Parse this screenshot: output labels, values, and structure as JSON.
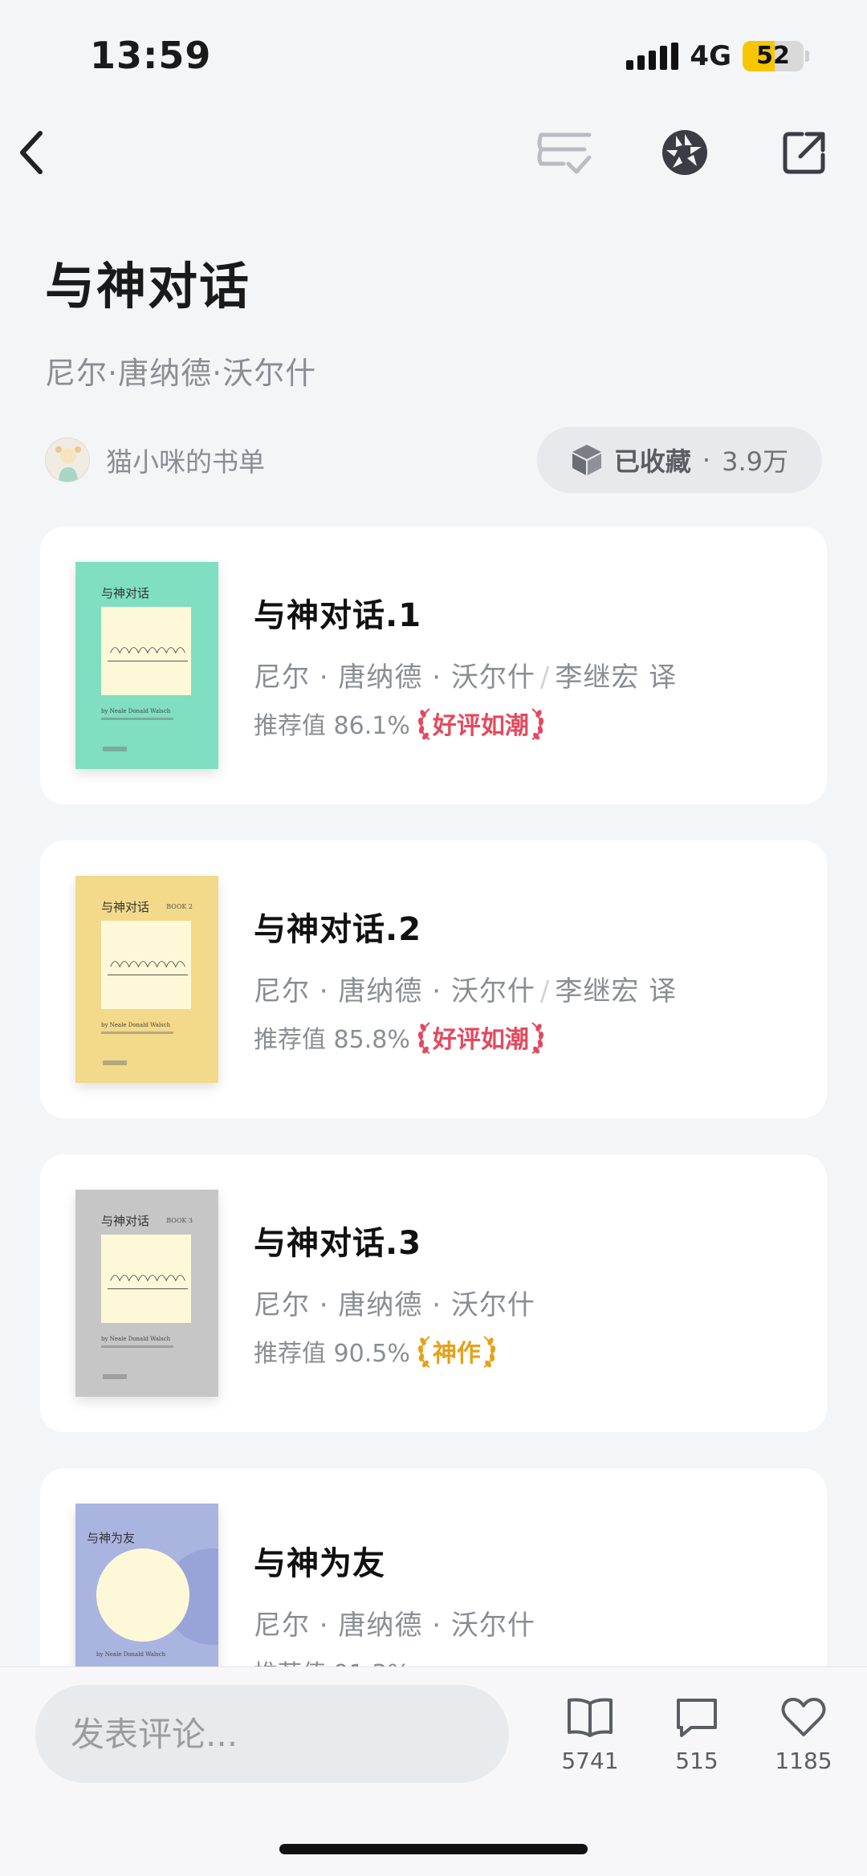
{
  "status_bar": {
    "time": "13:59",
    "network": "4G",
    "battery": "52"
  },
  "nav": {
    "back_icon": "chevron-left-icon",
    "list_check_icon": "list-check-icon",
    "shutter_icon": "aperture-icon",
    "share_icon": "share-out-icon"
  },
  "booklist": {
    "title": "与神对话",
    "subtitle": "尼尔·唐纳德·沃尔什",
    "curator_name": "猫小咪的书单",
    "collect_label": "已收藏",
    "collect_sep": "·",
    "collect_count": "3.9万"
  },
  "books": [
    {
      "title": "与神对话.1",
      "author": "尼尔 · 唐纳德 · 沃尔什",
      "translator": "李继宏 译",
      "rating_label": "推荐值 86.1%",
      "badge": "好评如潮",
      "badge_color": "#e5485e",
      "cover": {
        "color": "#7fdfc0",
        "title": "与神对话",
        "book_no": ""
      }
    },
    {
      "title": "与神对话.2",
      "author": "尼尔 · 唐纳德 · 沃尔什",
      "translator": "李继宏 译",
      "rating_label": "推荐值 85.8%",
      "badge": "好评如潮",
      "badge_color": "#e5485e",
      "cover": {
        "color": "#f3d98a",
        "title": "与神对话",
        "book_no": "BOOK 2"
      }
    },
    {
      "title": "与神对话.3",
      "author": "尼尔 · 唐纳德 · 沃尔什",
      "translator": "",
      "rating_label": "推荐值 90.5%",
      "badge": "神作",
      "badge_color": "#e6a119",
      "cover": {
        "color": "#c6c6c6",
        "title": "与神对话",
        "book_no": "BOOK 3"
      }
    },
    {
      "title": "与神为友",
      "author": "尼尔 · 唐纳德 · 沃尔什",
      "translator": "",
      "rating_label": "推荐值 91.3%",
      "badge": "",
      "badge_color": "",
      "cover": {
        "color": "#aab4e0",
        "title": "与神为友",
        "book_no": ""
      }
    }
  ],
  "bottom_bar": {
    "comment_placeholder": "发表评论...",
    "read_count": "5741",
    "comment_count": "515",
    "like_count": "1185"
  }
}
